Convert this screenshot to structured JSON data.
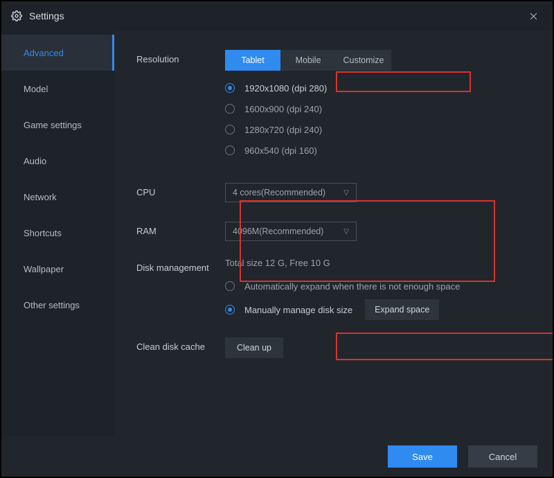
{
  "header": {
    "title": "Settings"
  },
  "sidebar": {
    "items": [
      {
        "label": "Advanced",
        "active": true
      },
      {
        "label": "Model"
      },
      {
        "label": "Game settings"
      },
      {
        "label": "Audio"
      },
      {
        "label": "Network"
      },
      {
        "label": "Shortcuts"
      },
      {
        "label": "Wallpaper"
      },
      {
        "label": "Other settings"
      }
    ]
  },
  "resolution": {
    "label": "Resolution",
    "tabs": {
      "tablet": "Tablet",
      "mobile": "Mobile",
      "customize": "Customize"
    },
    "options": [
      "1920x1080  (dpi 280)",
      "1600x900  (dpi 240)",
      "1280x720  (dpi 240)",
      "960x540  (dpi 160)"
    ]
  },
  "cpu": {
    "label": "CPU",
    "value": "4 cores(Recommended)"
  },
  "ram": {
    "label": "RAM",
    "value": "4096M(Recommended)"
  },
  "disk": {
    "label": "Disk management",
    "status": "Total size 12 G,  Free 10 G",
    "auto": "Automatically expand when there is not enough space",
    "manual": "Manually manage disk size",
    "expand": "Expand space"
  },
  "cache": {
    "label": "Clean disk cache",
    "button": "Clean up"
  },
  "footer": {
    "save": "Save",
    "cancel": "Cancel"
  }
}
